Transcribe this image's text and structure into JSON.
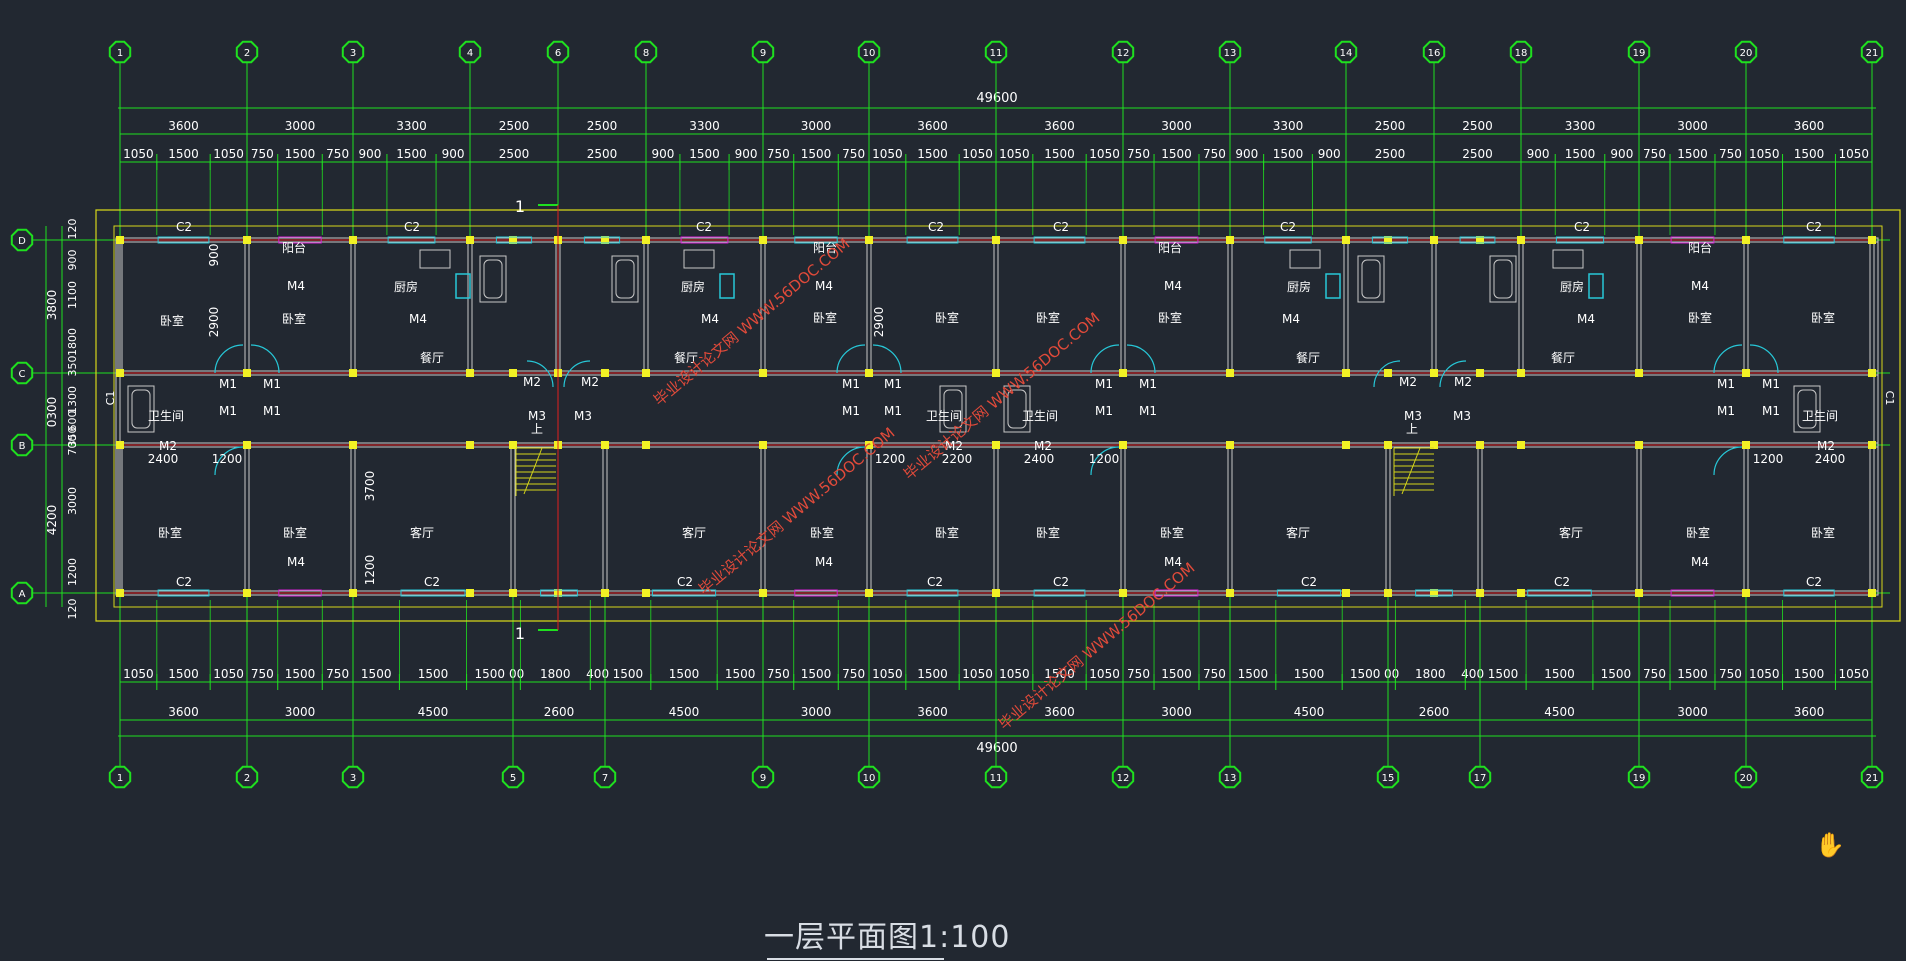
{
  "drawing": {
    "title": "一层平面图1:100",
    "total_dim": "49600",
    "cursor_icon": "hand-icon",
    "colors": {
      "background": "#222831",
      "axis": "#1fe01f",
      "wall": "#c8c8c8",
      "axisline": "#e0201f",
      "outline": "#d6d61a",
      "window": "#27c7d7",
      "balcony": "#d21fd2",
      "column": "#f1f124",
      "text": "#ffffff",
      "watermark": "#e04a3a"
    },
    "top_axes": [
      "1",
      "2",
      "3",
      "4",
      "6",
      "8",
      "9",
      "10",
      "11",
      "12",
      "13",
      "14",
      "16",
      "18",
      "19",
      "20",
      "21"
    ],
    "bottom_axes": [
      "1",
      "2",
      "3",
      "5",
      "7",
      "9",
      "10",
      "11",
      "12",
      "13",
      "15",
      "17",
      "19",
      "20",
      "21"
    ],
    "left_axes": [
      "D",
      "C",
      "B",
      "A"
    ],
    "top_dims_1": [
      "3600",
      "3000",
      "3300",
      "2500",
      "2500",
      "3300",
      "3000",
      "3600",
      "3600",
      "3000",
      "3300",
      "2500",
      "2500",
      "3300",
      "3000",
      "3600"
    ],
    "top_dims_2": [
      "1050",
      "1500",
      "1050",
      "750",
      "1500",
      "750",
      "900",
      "1500",
      "900",
      "2500",
      "2500",
      "900",
      "1500",
      "900",
      "750",
      "1500",
      "750",
      "1050",
      "1500",
      "1050",
      "1050",
      "1500",
      "1050",
      "750",
      "1500",
      "750",
      "900",
      "1500",
      "900",
      "2500",
      "2500",
      "900",
      "1500",
      "900",
      "750",
      "1500",
      "750",
      "1050",
      "1500",
      "1050"
    ],
    "bot_dims_1": [
      "3600",
      "3000",
      "4500",
      "2600",
      "4500",
      "3000",
      "3600",
      "3600",
      "3000",
      "4500",
      "2600",
      "4500",
      "3000",
      "3600"
    ],
    "bot_dims_2": [
      "1050",
      "1500",
      "1050",
      "750",
      "1500",
      "750",
      "1500",
      "1500",
      "1500",
      "00",
      "1800",
      "400",
      "1500",
      "1500",
      "1500",
      "750",
      "1500",
      "750",
      "1050",
      "1500",
      "1050",
      "1050",
      "1500",
      "1050",
      "750",
      "1500",
      "750",
      "1500",
      "1500",
      "1500",
      "00",
      "1800",
      "400",
      "1500",
      "1500",
      "1500",
      "750",
      "1500",
      "750",
      "1050",
      "1500",
      "1050"
    ],
    "left_dims_outer": [
      "3800",
      "0300",
      "4200"
    ],
    "left_dims_inner": [
      "120",
      "900",
      "1100",
      "1800",
      "350",
      "1300",
      "600",
      "350",
      "700",
      "3000",
      "1200",
      "120"
    ],
    "inner_dims": [
      "900",
      "2900",
      "2900",
      "3700",
      "1200",
      "2400",
      "1200",
      "1200",
      "2400",
      "1200",
      "1200",
      "2400",
      "1200",
      "2400"
    ],
    "rooms": {
      "bedroom": "卧室",
      "balcony": "阳台",
      "kitchen": "厨房",
      "dining": "餐厅",
      "living": "客厅",
      "bathroom": "卫生间",
      "up": "上"
    },
    "door_tags": [
      "M1",
      "M2",
      "M3",
      "M4"
    ],
    "window_tags": [
      "C1",
      "C2"
    ],
    "section_mark": "1",
    "watermarks": [
      "毕业设计论文网",
      "WWW.56DOC.COM"
    ]
  }
}
